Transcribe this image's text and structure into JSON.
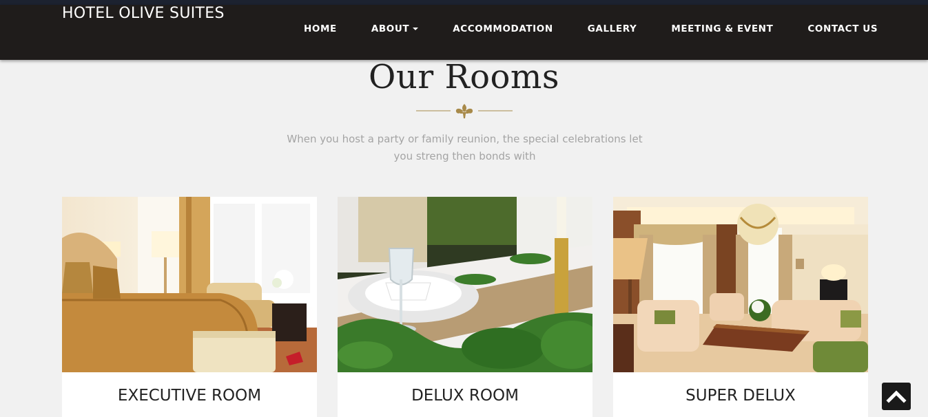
{
  "header": {
    "brand": "HOTEL OLIVE SUITES",
    "nav": [
      {
        "label": "HOME"
      },
      {
        "label": "ABOUT"
      },
      {
        "label": "ACCOMMODATION"
      },
      {
        "label": "GALLERY"
      },
      {
        "label": "MEETING & EVENT"
      },
      {
        "label": "CONTACT US"
      }
    ]
  },
  "section": {
    "title": "Our Rooms",
    "subtitle_line1": "When you host a party or family reunion, the special celebrations let",
    "subtitle_line2": "you streng then bonds with"
  },
  "rooms": [
    {
      "name": "EXECUTIVE ROOM"
    },
    {
      "name": "DELUX ROOM"
    },
    {
      "name": "SUPER DELUX"
    }
  ],
  "colors": {
    "navbar": "#1f1c1b",
    "accent_gold": "#a88a4a",
    "background": "#f1f1f1"
  },
  "icons": {
    "ornament": "fleur-de-lis-icon",
    "scroll_top": "chevron-up-icon",
    "about_dropdown": "caret-down-icon"
  }
}
